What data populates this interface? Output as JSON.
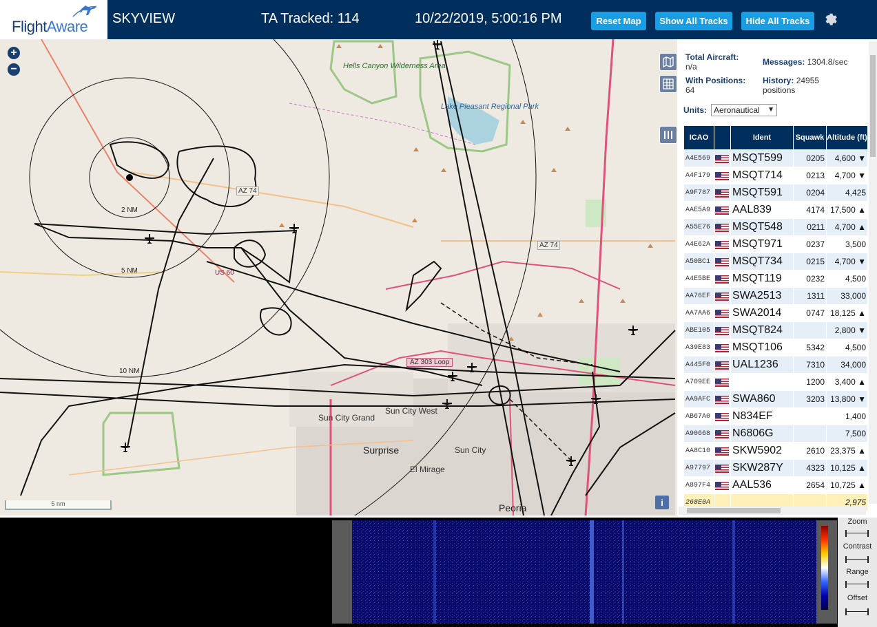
{
  "header": {
    "logo_word": "Flight",
    "logo_word2": "Aware",
    "title": "SKYVIEW",
    "tracked": "TA Tracked: 114",
    "datetime": "10/22/2019, 5:00:16 PM",
    "reset_label": "Reset Map",
    "show_label": "Show All Tracks",
    "hide_label": "Hide All Tracks"
  },
  "map": {
    "labels": {
      "hells_canyon": "Hells Canyon Wilderness Area",
      "lake": "Lake Pleasant Regional Park",
      "surprise": "Surprise",
      "sun_city": "Sun City",
      "sun_city_west": "Sun City West",
      "sun_city_grand": "Sun City Grand",
      "el_mirage": "El Mirage",
      "peoria": "Peoria",
      "az74a": "AZ 74",
      "az74b": "AZ 74",
      "us60": "US 60",
      "loop303": "AZ 303 Loop"
    },
    "rings": {
      "r2": "2 NM",
      "r5": "5 NM",
      "r10": "10 NM"
    },
    "scale": "5 nm",
    "info": "i"
  },
  "stats": {
    "total_label": "Total Aircraft:",
    "total_value": "n/a",
    "messages_label": "Messages:",
    "messages_value": "1304.8/sec",
    "positions_label": "With Positions:",
    "positions_value": "64",
    "history_label": "History:",
    "history_value": "24955 positions",
    "units_label": "Units:",
    "units_value": "Aeronautical"
  },
  "table": {
    "headers": {
      "icao": "ICAO",
      "ident": "Ident",
      "squawk": "Squawk",
      "altitude": "Altitude (ft)"
    },
    "rows": [
      {
        "icao": "A4E569",
        "ident": "MSQT599",
        "squawk": "0205",
        "alt": "4,600 ▼"
      },
      {
        "icao": "A4F179",
        "ident": "MSQT714",
        "squawk": "0213",
        "alt": "4,700 ▼"
      },
      {
        "icao": "A9F787",
        "ident": "MSQT591",
        "squawk": "0204",
        "alt": "4,425"
      },
      {
        "icao": "AAE5A9",
        "ident": "AAL839",
        "squawk": "4174",
        "alt": "17,500 ▲"
      },
      {
        "icao": "A55E76",
        "ident": "MSQT548",
        "squawk": "0211",
        "alt": "4,700 ▲"
      },
      {
        "icao": "A4E62A",
        "ident": "MSQT971",
        "squawk": "0237",
        "alt": "3,500"
      },
      {
        "icao": "A50BC1",
        "ident": "MSQT734",
        "squawk": "0215",
        "alt": "4,700 ▼"
      },
      {
        "icao": "A4E5BE",
        "ident": "MSQT119",
        "squawk": "0232",
        "alt": "4,500"
      },
      {
        "icao": "AA76EF",
        "ident": "SWA2513",
        "squawk": "1311",
        "alt": "33,000"
      },
      {
        "icao": "AA7AA6",
        "ident": "SWA2014",
        "squawk": "0747",
        "alt": "18,125 ▲"
      },
      {
        "icao": "ABE105",
        "ident": "MSQT824",
        "squawk": "",
        "alt": "2,800 ▼"
      },
      {
        "icao": "A39E83",
        "ident": "MSQT106",
        "squawk": "5342",
        "alt": "4,500"
      },
      {
        "icao": "A445F0",
        "ident": "UAL1236",
        "squawk": "7310",
        "alt": "34,000"
      },
      {
        "icao": "A709EE",
        "ident": "",
        "squawk": "1200",
        "alt": "3,400 ▲"
      },
      {
        "icao": "AA9AFC",
        "ident": "SWA860",
        "squawk": "3203",
        "alt": "13,800 ▼"
      },
      {
        "icao": "AB67A0",
        "ident": "N834EF",
        "squawk": "",
        "alt": "1,400"
      },
      {
        "icao": "A90668",
        "ident": "N6806G",
        "squawk": "",
        "alt": "7,500"
      },
      {
        "icao": "AA8C10",
        "ident": "SKW5902",
        "squawk": "2610",
        "alt": "23,375 ▲"
      },
      {
        "icao": "A97797",
        "ident": "SKW287Y",
        "squawk": "4323",
        "alt": "10,125 ▲"
      },
      {
        "icao": "A897F4",
        "ident": "AAL536",
        "squawk": "2654",
        "alt": "10,725 ▲"
      },
      {
        "icao": "268E0A",
        "ident": "",
        "squawk": "",
        "alt": "2,975"
      }
    ]
  },
  "waterfall": {
    "zoom": "Zoom",
    "contrast": "Contrast",
    "range": "Range",
    "offset": "Offset"
  },
  "colors": {
    "header_bg": "#002f5d",
    "button": "#1a9ee3",
    "table_header": "#002f5d",
    "selected_row": "#fff1b8"
  }
}
